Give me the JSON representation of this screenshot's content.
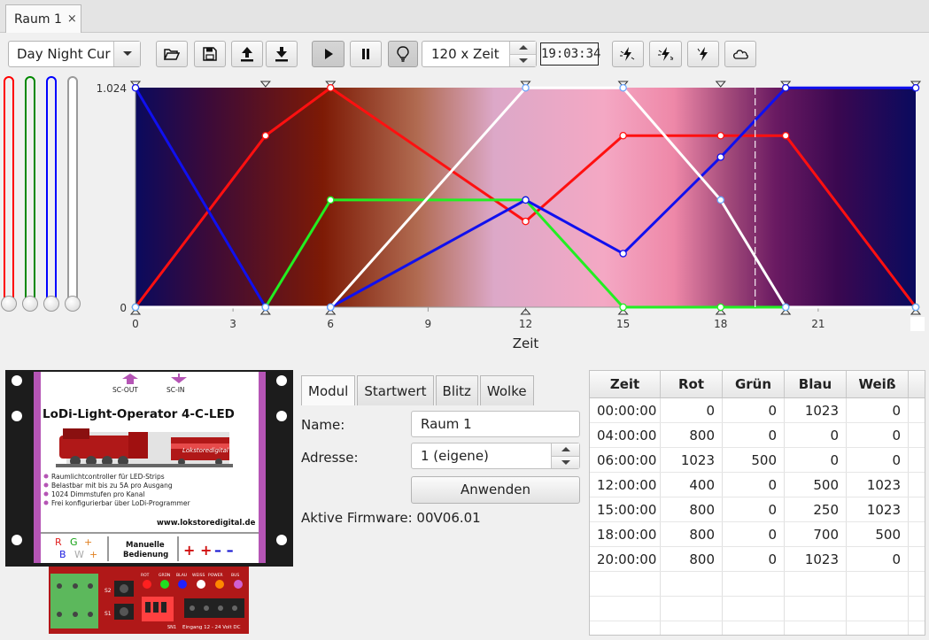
{
  "window": {
    "tab_label": "Raum 1",
    "tab_close": "×"
  },
  "toolbar": {
    "curve_select": "Day Night Cur",
    "speed": "120 x Zeit",
    "clock": "19:03:34",
    "icons": [
      "folder-open-icon",
      "save-icon",
      "upload-icon",
      "download-icon",
      "play-icon",
      "pause-icon",
      "bulb-icon",
      "flash-icon",
      "flash-icon",
      "flash-icon",
      "cloud-icon"
    ]
  },
  "sliders": [
    {
      "color": "#ff0000"
    },
    {
      "color": "#00aa00"
    },
    {
      "color": "#0000ff"
    },
    {
      "color": "#ffffff"
    }
  ],
  "chart_data": {
    "type": "line",
    "xlabel": "Zeit",
    "xlim": [
      0,
      24
    ],
    "ylim": [
      0,
      1024
    ],
    "x_ticks": [
      "0",
      "3",
      "6",
      "9",
      "12",
      "15",
      "18",
      "21"
    ],
    "y_ticks": [
      "0",
      "1.024"
    ],
    "current_time": 19.06,
    "x": [
      0,
      4,
      6,
      12,
      15,
      18,
      20,
      24
    ],
    "series": [
      {
        "key": "red",
        "color": "#ff1010",
        "values": [
          0,
          800,
          1023,
          400,
          800,
          800,
          800,
          0
        ]
      },
      {
        "key": "green",
        "color": "#22ee22",
        "values": [
          0,
          0,
          500,
          500,
          0,
          0,
          0,
          0
        ]
      },
      {
        "key": "blue",
        "color": "#1010ee",
        "values": [
          1023,
          0,
          0,
          500,
          250,
          700,
          1023,
          1023
        ]
      },
      {
        "key": "white",
        "color": "#ffffff",
        "values": [
          0,
          0,
          0,
          1023,
          1023,
          500,
          0,
          0
        ]
      }
    ]
  },
  "module": {
    "port_out": "SC-OUT",
    "port_in": "SC-IN",
    "title": "LoDi-Light-Operator  4-C-LED",
    "brand": "Lokstoredigital",
    "features": [
      "Raumlichtcontroller für LED-Strips",
      "Belastbar mit bis zu 5A pro Ausgang",
      "1024 Dimmstufen pro Kanal",
      "Frei konfigurierbar über LoDi-Programmer"
    ],
    "url": "www.lokstoredigital.de",
    "legend_r": "R",
    "legend_g": "G",
    "legend_plus1": "+",
    "legend_b": "B",
    "legend_w": "W",
    "legend_plus2": "+",
    "manual_label_1": "Manuelle",
    "manual_label_2": "Bedienung",
    "plus_signs": "+ +",
    "minus_signs": "– –",
    "board_leds": [
      "ROT",
      "GRÜN",
      "BLAU",
      "WEISS",
      "POWER",
      "BUS"
    ],
    "s2": "S2",
    "s1": "S1",
    "sn1": "SN1",
    "input_label": "Eingang 12 - 24 Volt DC"
  },
  "props": {
    "tabs": [
      "Modul",
      "Startwert",
      "Blitz",
      "Wolke"
    ],
    "name_label": "Name:",
    "name_value": "Raum 1",
    "address_label": "Adresse:",
    "address_value": "1 (eigene)",
    "apply_label": "Anwenden",
    "firmware_label": "Aktive Firmware: 00V06.01"
  },
  "table": {
    "headers": [
      "Zeit",
      "Rot",
      "Grün",
      "Blau",
      "Weiß"
    ],
    "rows": [
      [
        "00:00:00",
        "0",
        "0",
        "1023",
        "0"
      ],
      [
        "04:00:00",
        "800",
        "0",
        "0",
        "0"
      ],
      [
        "06:00:00",
        "1023",
        "500",
        "0",
        "0"
      ],
      [
        "12:00:00",
        "400",
        "0",
        "500",
        "1023"
      ],
      [
        "15:00:00",
        "800",
        "0",
        "250",
        "1023"
      ],
      [
        "18:00:00",
        "800",
        "0",
        "700",
        "500"
      ],
      [
        "20:00:00",
        "800",
        "0",
        "1023",
        "0"
      ]
    ],
    "empty_rows": 3
  }
}
